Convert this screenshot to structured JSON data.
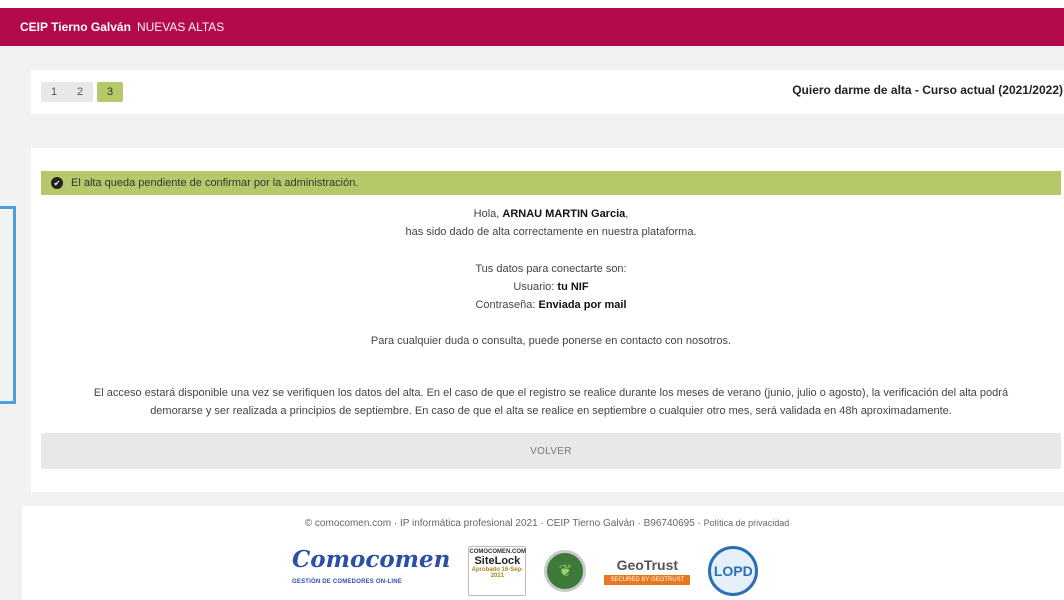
{
  "header": {
    "brand": "CEIP Tierno Galván",
    "section": "NUEVAS ALTAS"
  },
  "steps": {
    "items": [
      "1",
      "2",
      "3"
    ],
    "active_index": 2,
    "title": "Quiero darme de alta - Curso actual (2021/2022)"
  },
  "alert": {
    "icon": "check-circle-icon",
    "text": "El alta queda pendiente de confirmar por la administración."
  },
  "greeting": {
    "hello": "Hola,",
    "name": "ARNAU MARTIN Garcia",
    "comma": ",",
    "line2": "has sido dado de alta correctamente en nuestra plataforma."
  },
  "credentials": {
    "intro": "Tus datos para conectarte son:",
    "user_label": "Usuario:",
    "user_value": "tu NIF",
    "password_label": "Contraseña:",
    "password_value": "Enviada por mail"
  },
  "contact": "Para cualquier duda o consulta, puede ponerse en contacto con nosotros.",
  "notice": {
    "line1": "El acceso estará disponible una vez se verifiquen los datos del alta. En el caso de que el registro se realice durante los meses de verano (junio, julio o agosto), la verificación del alta podrá",
    "line2": "demorarse y ser realizada a principios de septiembre. En caso de que el alta se realice en septiembre o cualquier otro mes, será validada en 48h aproximadamente."
  },
  "volver_label": "VOLVER",
  "footer": {
    "text": "© comocomen.com · IP informática profesional 2021 · CEIP Tierno Galván · B96740695 ·",
    "privacy": "Política de privacidad",
    "logos": {
      "comocomen": "Comocomen",
      "comocomen_sub": "GESTIÓN DE COMEDORES ON-LINE",
      "sitelock_top": "COMOCOMEN.COM",
      "sitelock_main": "SiteLock",
      "sitelock_bot": "Aprobado 16-Sep-2021",
      "geotrust": "GeoTrust",
      "geotrust_bar": "SECURED BY GEOTRUST",
      "lopd": "LOPD"
    }
  },
  "colors": {
    "brand": "#b3094d",
    "success": "#b6c96a"
  }
}
